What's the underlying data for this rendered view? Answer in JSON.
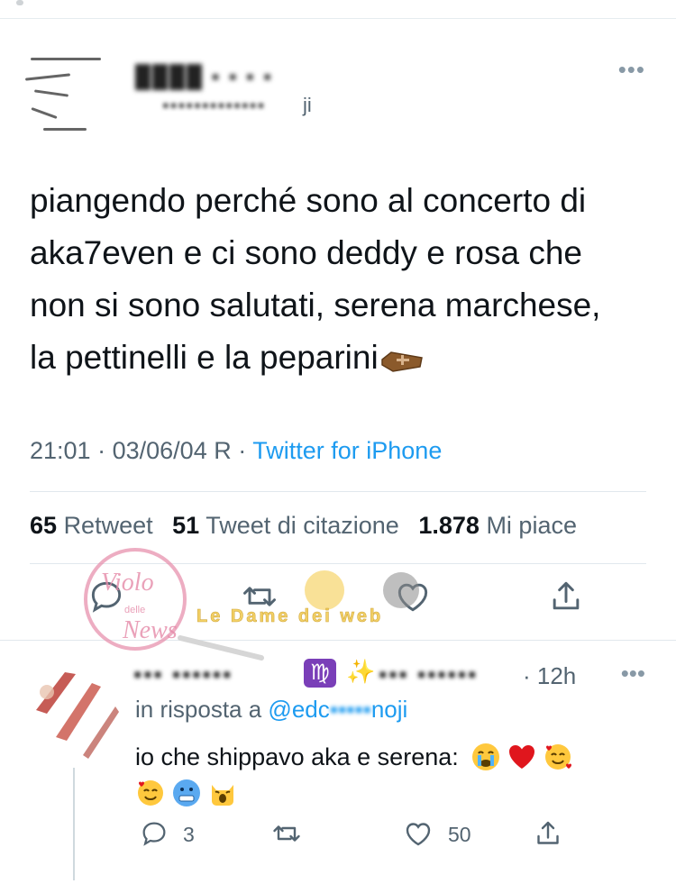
{
  "tweet": {
    "handle_tail": "ji",
    "text_lines": [
      "piangendo perché sono al concerto di",
      "aka7even e ci sono deddy e rosa che",
      "non si sono salutati, serena marchese,",
      "la pettinelli e la peparini"
    ],
    "time": "21:01",
    "date": "03/06/04 R",
    "separator": "·",
    "source": "Twitter for iPhone",
    "retweets_count": "65",
    "retweets_label": "Retweet",
    "quotes_count": "51",
    "quotes_label": "Tweet di citazione",
    "likes_count": "1.878",
    "likes_label": "Mi piace"
  },
  "watermark": {
    "brand_line1": "Violo",
    "brand_line2": "delle",
    "brand_line3": "News",
    "text": "Le Dame dei web"
  },
  "reply": {
    "time": "· 12h",
    "in_reply_prefix": "in risposta a",
    "mention_start": "@edc",
    "mention_end": "noji",
    "text": "io che shippavo aka e serena:",
    "reply_count": "3",
    "like_count": "50"
  },
  "colors": {
    "accent": "#1d9bf0",
    "muted": "#536471",
    "divider": "#e1e8ed"
  },
  "icons": [
    "reply-icon",
    "retweet-icon",
    "like-icon",
    "share-icon",
    "more-icon",
    "coffin-emoji",
    "virgo-icon",
    "sparkles-icon"
  ]
}
